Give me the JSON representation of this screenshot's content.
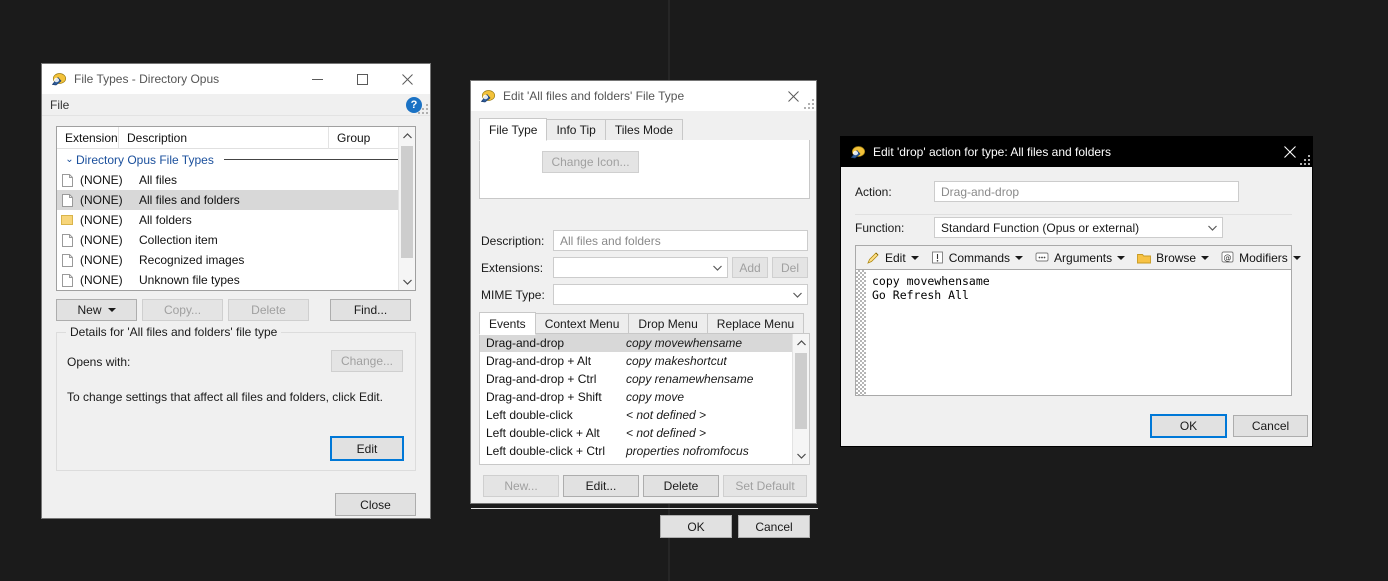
{
  "desktop": {
    "background": "#1b1b1b"
  },
  "window_filetypes": {
    "title": "File Types - Directory Opus",
    "icon": "opus-icon",
    "minimize": "—",
    "maximize": "☐",
    "close": "✕",
    "menu": {
      "file": "File",
      "help": "?"
    },
    "columns": {
      "extension": "Extension",
      "description": "Description",
      "group": "Group"
    },
    "group_row": {
      "label": "Directory Opus File Types",
      "chevron": "⌄"
    },
    "rows": [
      {
        "icon": "file-icon",
        "ext": "(NONE)",
        "desc": "All files",
        "selected": false
      },
      {
        "icon": "file-icon",
        "ext": "(NONE)",
        "desc": "All files and folders",
        "selected": true
      },
      {
        "icon": "folder-icon",
        "ext": "(NONE)",
        "desc": "All folders",
        "selected": false
      },
      {
        "icon": "file-icon",
        "ext": "(NONE)",
        "desc": "Collection item",
        "selected": false
      },
      {
        "icon": "file-icon",
        "ext": "(NONE)",
        "desc": "Recognized images",
        "selected": false
      },
      {
        "icon": "file-icon",
        "ext": "(NONE)",
        "desc": "Unknown file types",
        "selected": false
      }
    ],
    "buttons": {
      "new": "New",
      "copy": "Copy...",
      "delete": "Delete",
      "find": "Find...",
      "change": "Change...",
      "edit": "Edit",
      "close": "Close"
    },
    "details": {
      "legend": "Details for 'All files and folders' file type",
      "opens_with_label": "Opens with:",
      "hint": "To change settings that affect all files and folders, click Edit."
    }
  },
  "window_edit_filetype": {
    "title": "Edit 'All files and folders' File Type",
    "icon": "opus-icon",
    "close": "✕",
    "tabs": [
      {
        "label": "File Type",
        "active": true
      },
      {
        "label": "Info Tip",
        "active": false
      },
      {
        "label": "Tiles Mode",
        "active": false
      }
    ],
    "change_icon_button": "Change Icon...",
    "fields": {
      "description_label": "Description:",
      "description_value": "All files and folders",
      "extensions_label": "Extensions:",
      "extensions_value": "",
      "mime_label": "MIME Type:",
      "mime_value": ""
    },
    "ext_buttons": {
      "add": "Add",
      "del": "Del"
    },
    "inner_tabs": [
      {
        "label": "Events",
        "active": true
      },
      {
        "label": "Context Menu",
        "active": false
      },
      {
        "label": "Drop Menu",
        "active": false
      },
      {
        "label": "Replace Menu",
        "active": false
      }
    ],
    "events": [
      {
        "name": "Drag-and-drop",
        "value": "copy movewhensame",
        "selected": true
      },
      {
        "name": "Drag-and-drop + Alt",
        "value": "copy makeshortcut",
        "selected": false
      },
      {
        "name": "Drag-and-drop + Ctrl",
        "value": "copy renamewhensame",
        "selected": false
      },
      {
        "name": "Drag-and-drop + Shift",
        "value": "copy move",
        "selected": false
      },
      {
        "name": "Left double-click",
        "value": "< not defined >",
        "selected": false
      },
      {
        "name": "Left double-click + Alt",
        "value": "< not defined >",
        "selected": false
      },
      {
        "name": "Left double-click + Ctrl",
        "value": "properties nofromfocus",
        "selected": false
      }
    ],
    "list_buttons": {
      "new": "New...",
      "edit": "Edit...",
      "delete": "Delete",
      "set_default": "Set Default"
    },
    "ok": "OK",
    "cancel": "Cancel"
  },
  "window_edit_action": {
    "title": "Edit 'drop' action for type: All files and folders",
    "icon": "opus-icon",
    "close": "✕",
    "action_label": "Action:",
    "action_value": "Drag-and-drop",
    "function_label": "Function:",
    "function_value": "Standard Function (Opus or external)",
    "toolbar": [
      {
        "label": "Edit",
        "icon": "pencil-icon"
      },
      {
        "label": "Commands",
        "icon": "exclamation-icon"
      },
      {
        "label": "Arguments",
        "icon": "arguments-icon"
      },
      {
        "label": "Browse",
        "icon": "folder-icon"
      },
      {
        "label": "Modifiers",
        "icon": "at-icon"
      }
    ],
    "script_text": "copy movewhensame\nGo Refresh All",
    "ok": "OK",
    "cancel": "Cancel"
  }
}
